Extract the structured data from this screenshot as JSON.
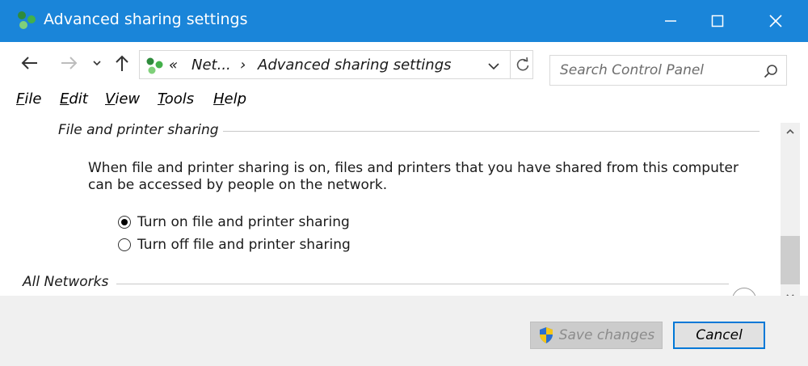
{
  "window": {
    "title": "Advanced sharing settings"
  },
  "address": {
    "chevrons": "«",
    "crumb1": "Net...",
    "separator": "›",
    "crumb2": "Advanced sharing settings"
  },
  "search": {
    "placeholder": "Search Control Panel"
  },
  "menu": {
    "file": {
      "ul": "F",
      "rest": "ile"
    },
    "edit": {
      "ul": "E",
      "rest": "dit"
    },
    "view": {
      "ul": "V",
      "rest": "iew"
    },
    "tools": {
      "ul": "T",
      "rest": "ools"
    },
    "help": {
      "ul": "H",
      "rest": "elp"
    }
  },
  "section": {
    "title": "File and printer sharing",
    "description": "When file and printer sharing is on, files and printers that you have shared from this computer can be accessed by people on the network.",
    "options": [
      {
        "label": "Turn on file and printer sharing",
        "selected": true
      },
      {
        "label": "Turn off file and printer sharing",
        "selected": false
      }
    ]
  },
  "all_networks": {
    "title": "All Networks"
  },
  "footer": {
    "save_label": "Save changes",
    "cancel_label": "Cancel"
  },
  "colors": {
    "titlebar": "#1a85d9",
    "accent": "#0078d7"
  }
}
